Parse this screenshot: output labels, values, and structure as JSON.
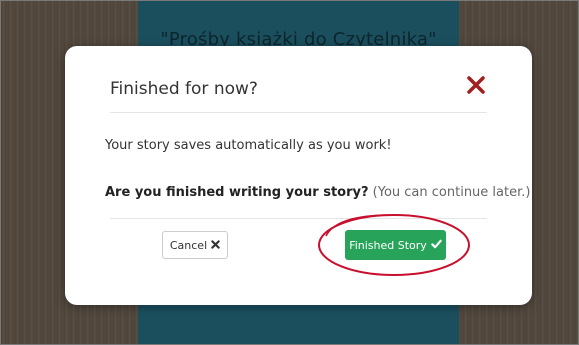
{
  "background": {
    "title": "\"Prośby książki do Czytelnika\""
  },
  "modal": {
    "title": "Finished for now?",
    "message": "Your story saves automatically as you work!",
    "question_bold": "Are you finished writing your story?",
    "question_hint": "(You can continue later.)",
    "cancel_label": "Cancel",
    "finish_label": "Finished Story"
  },
  "icons": {
    "close": "close-icon",
    "cancel": "times-icon",
    "finish": "check-icon"
  },
  "colors": {
    "close_x": "#a01f1f",
    "finish_button": "#28a45a",
    "annotation": "#c8102e",
    "background_column": "#1f5a6b"
  }
}
